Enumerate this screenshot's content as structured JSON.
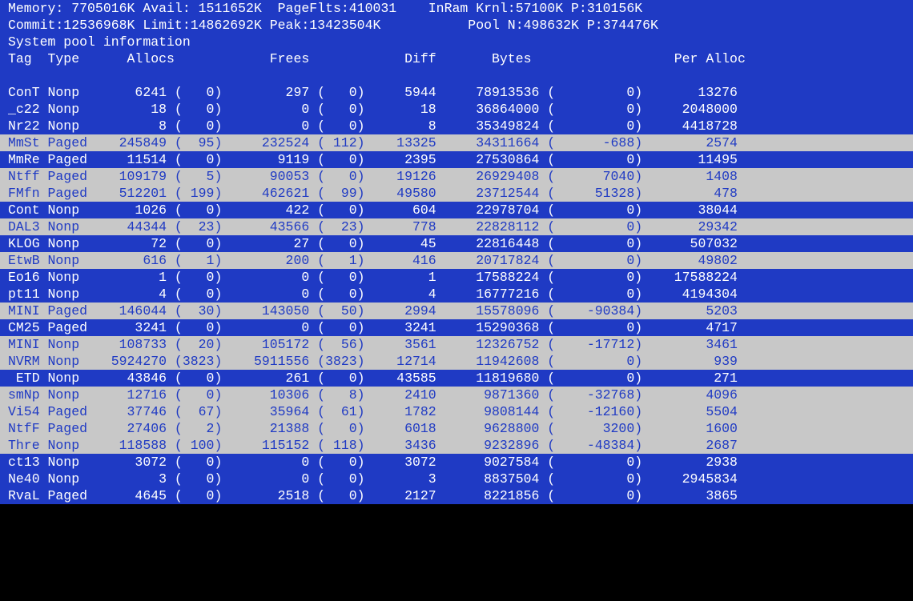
{
  "header": {
    "line1": "Memory: 7705016K Avail: 1511652K  PageFlts:410031    InRam Krnl:57100K P:310156K",
    "line2": "Commit:12536968K Limit:14862692K Peak:13423504K           Pool N:498632K P:374476K",
    "line3": "System pool information"
  },
  "columns": "Tag  Type      Allocs            Frees            Diff       Bytes                  Per Alloc",
  "rows": [
    {
      "style": "blue",
      "tag": "ConT",
      "type": "Nonp",
      "allocs": "6241",
      "allocs_d": "0",
      "frees": "297",
      "frees_d": "0",
      "diff": "5944",
      "bytes": "78913536",
      "bytes_d": "0",
      "per": "13276"
    },
    {
      "style": "blue",
      "tag": "_c22",
      "type": "Nonp",
      "allocs": "18",
      "allocs_d": "0",
      "frees": "0",
      "frees_d": "0",
      "diff": "18",
      "bytes": "36864000",
      "bytes_d": "0",
      "per": "2048000"
    },
    {
      "style": "blue",
      "tag": "Nr22",
      "type": "Nonp",
      "allocs": "8",
      "allocs_d": "0",
      "frees": "0",
      "frees_d": "0",
      "diff": "8",
      "bytes": "35349824",
      "bytes_d": "0",
      "per": "4418728"
    },
    {
      "style": "gray",
      "tag": "MmSt",
      "type": "Paged",
      "allocs": "245849",
      "allocs_d": "95",
      "frees": "232524",
      "frees_d": "112",
      "diff": "13325",
      "bytes": "34311664",
      "bytes_d": "-688",
      "per": "2574"
    },
    {
      "style": "blue",
      "tag": "MmRe",
      "type": "Paged",
      "allocs": "11514",
      "allocs_d": "0",
      "frees": "9119",
      "frees_d": "0",
      "diff": "2395",
      "bytes": "27530864",
      "bytes_d": "0",
      "per": "11495"
    },
    {
      "style": "gray",
      "tag": "Ntff",
      "type": "Paged",
      "allocs": "109179",
      "allocs_d": "5",
      "frees": "90053",
      "frees_d": "0",
      "diff": "19126",
      "bytes": "26929408",
      "bytes_d": "7040",
      "per": "1408"
    },
    {
      "style": "gray",
      "tag": "FMfn",
      "type": "Paged",
      "allocs": "512201",
      "allocs_d": "199",
      "frees": "462621",
      "frees_d": "99",
      "diff": "49580",
      "bytes": "23712544",
      "bytes_d": "51328",
      "per": "478"
    },
    {
      "style": "blue",
      "tag": "Cont",
      "type": "Nonp",
      "allocs": "1026",
      "allocs_d": "0",
      "frees": "422",
      "frees_d": "0",
      "diff": "604",
      "bytes": "22978704",
      "bytes_d": "0",
      "per": "38044"
    },
    {
      "style": "gray",
      "tag": "DAL3",
      "type": "Nonp",
      "allocs": "44344",
      "allocs_d": "23",
      "frees": "43566",
      "frees_d": "23",
      "diff": "778",
      "bytes": "22828112",
      "bytes_d": "0",
      "per": "29342"
    },
    {
      "style": "blue",
      "tag": "KLOG",
      "type": "Nonp",
      "allocs": "72",
      "allocs_d": "0",
      "frees": "27",
      "frees_d": "0",
      "diff": "45",
      "bytes": "22816448",
      "bytes_d": "0",
      "per": "507032"
    },
    {
      "style": "gray",
      "tag": "EtwB",
      "type": "Nonp",
      "allocs": "616",
      "allocs_d": "1",
      "frees": "200",
      "frees_d": "1",
      "diff": "416",
      "bytes": "20717824",
      "bytes_d": "0",
      "per": "49802"
    },
    {
      "style": "blue",
      "tag": "Eo16",
      "type": "Nonp",
      "allocs": "1",
      "allocs_d": "0",
      "frees": "0",
      "frees_d": "0",
      "diff": "1",
      "bytes": "17588224",
      "bytes_d": "0",
      "per": "17588224"
    },
    {
      "style": "blue",
      "tag": "pt11",
      "type": "Nonp",
      "allocs": "4",
      "allocs_d": "0",
      "frees": "0",
      "frees_d": "0",
      "diff": "4",
      "bytes": "16777216",
      "bytes_d": "0",
      "per": "4194304"
    },
    {
      "style": "gray",
      "tag": "MINI",
      "type": "Paged",
      "allocs": "146044",
      "allocs_d": "30",
      "frees": "143050",
      "frees_d": "50",
      "diff": "2994",
      "bytes": "15578096",
      "bytes_d": "-90384",
      "per": "5203"
    },
    {
      "style": "blue",
      "tag": "CM25",
      "type": "Paged",
      "allocs": "3241",
      "allocs_d": "0",
      "frees": "0",
      "frees_d": "0",
      "diff": "3241",
      "bytes": "15290368",
      "bytes_d": "0",
      "per": "4717"
    },
    {
      "style": "gray",
      "tag": "MINI",
      "type": "Nonp",
      "allocs": "108733",
      "allocs_d": "20",
      "frees": "105172",
      "frees_d": "56",
      "diff": "3561",
      "bytes": "12326752",
      "bytes_d": "-17712",
      "per": "3461"
    },
    {
      "style": "gray",
      "tag": "NVRM",
      "type": "Nonp",
      "allocs": "5924270",
      "allocs_d": "3823",
      "frees": "5911556",
      "frees_d": "3823",
      "diff": "12714",
      "bytes": "11942608",
      "bytes_d": "0",
      "per": "939"
    },
    {
      "style": "blue",
      "tag": " ETD",
      "type": "Nonp",
      "allocs": "43846",
      "allocs_d": "0",
      "frees": "261",
      "frees_d": "0",
      "diff": "43585",
      "bytes": "11819680",
      "bytes_d": "0",
      "per": "271"
    },
    {
      "style": "gray",
      "tag": "smNp",
      "type": "Nonp",
      "allocs": "12716",
      "allocs_d": "0",
      "frees": "10306",
      "frees_d": "8",
      "diff": "2410",
      "bytes": "9871360",
      "bytes_d": "-32768",
      "per": "4096"
    },
    {
      "style": "gray",
      "tag": "Vi54",
      "type": "Paged",
      "allocs": "37746",
      "allocs_d": "67",
      "frees": "35964",
      "frees_d": "61",
      "diff": "1782",
      "bytes": "9808144",
      "bytes_d": "-12160",
      "per": "5504"
    },
    {
      "style": "gray",
      "tag": "NtfF",
      "type": "Paged",
      "allocs": "27406",
      "allocs_d": "2",
      "frees": "21388",
      "frees_d": "0",
      "diff": "6018",
      "bytes": "9628800",
      "bytes_d": "3200",
      "per": "1600"
    },
    {
      "style": "gray",
      "tag": "Thre",
      "type": "Nonp",
      "allocs": "118588",
      "allocs_d": "100",
      "frees": "115152",
      "frees_d": "118",
      "diff": "3436",
      "bytes": "9232896",
      "bytes_d": "-48384",
      "per": "2687"
    },
    {
      "style": "blue",
      "tag": "ct13",
      "type": "Nonp",
      "allocs": "3072",
      "allocs_d": "0",
      "frees": "0",
      "frees_d": "0",
      "diff": "3072",
      "bytes": "9027584",
      "bytes_d": "0",
      "per": "2938"
    },
    {
      "style": "blue",
      "tag": "Ne40",
      "type": "Nonp",
      "allocs": "3",
      "allocs_d": "0",
      "frees": "0",
      "frees_d": "0",
      "diff": "3",
      "bytes": "8837504",
      "bytes_d": "0",
      "per": "2945834"
    },
    {
      "style": "blue",
      "tag": "RvaL",
      "type": "Paged",
      "allocs": "4645",
      "allocs_d": "0",
      "frees": "2518",
      "frees_d": "0",
      "diff": "2127",
      "bytes": "8221856",
      "bytes_d": "0",
      "per": "3865"
    }
  ]
}
